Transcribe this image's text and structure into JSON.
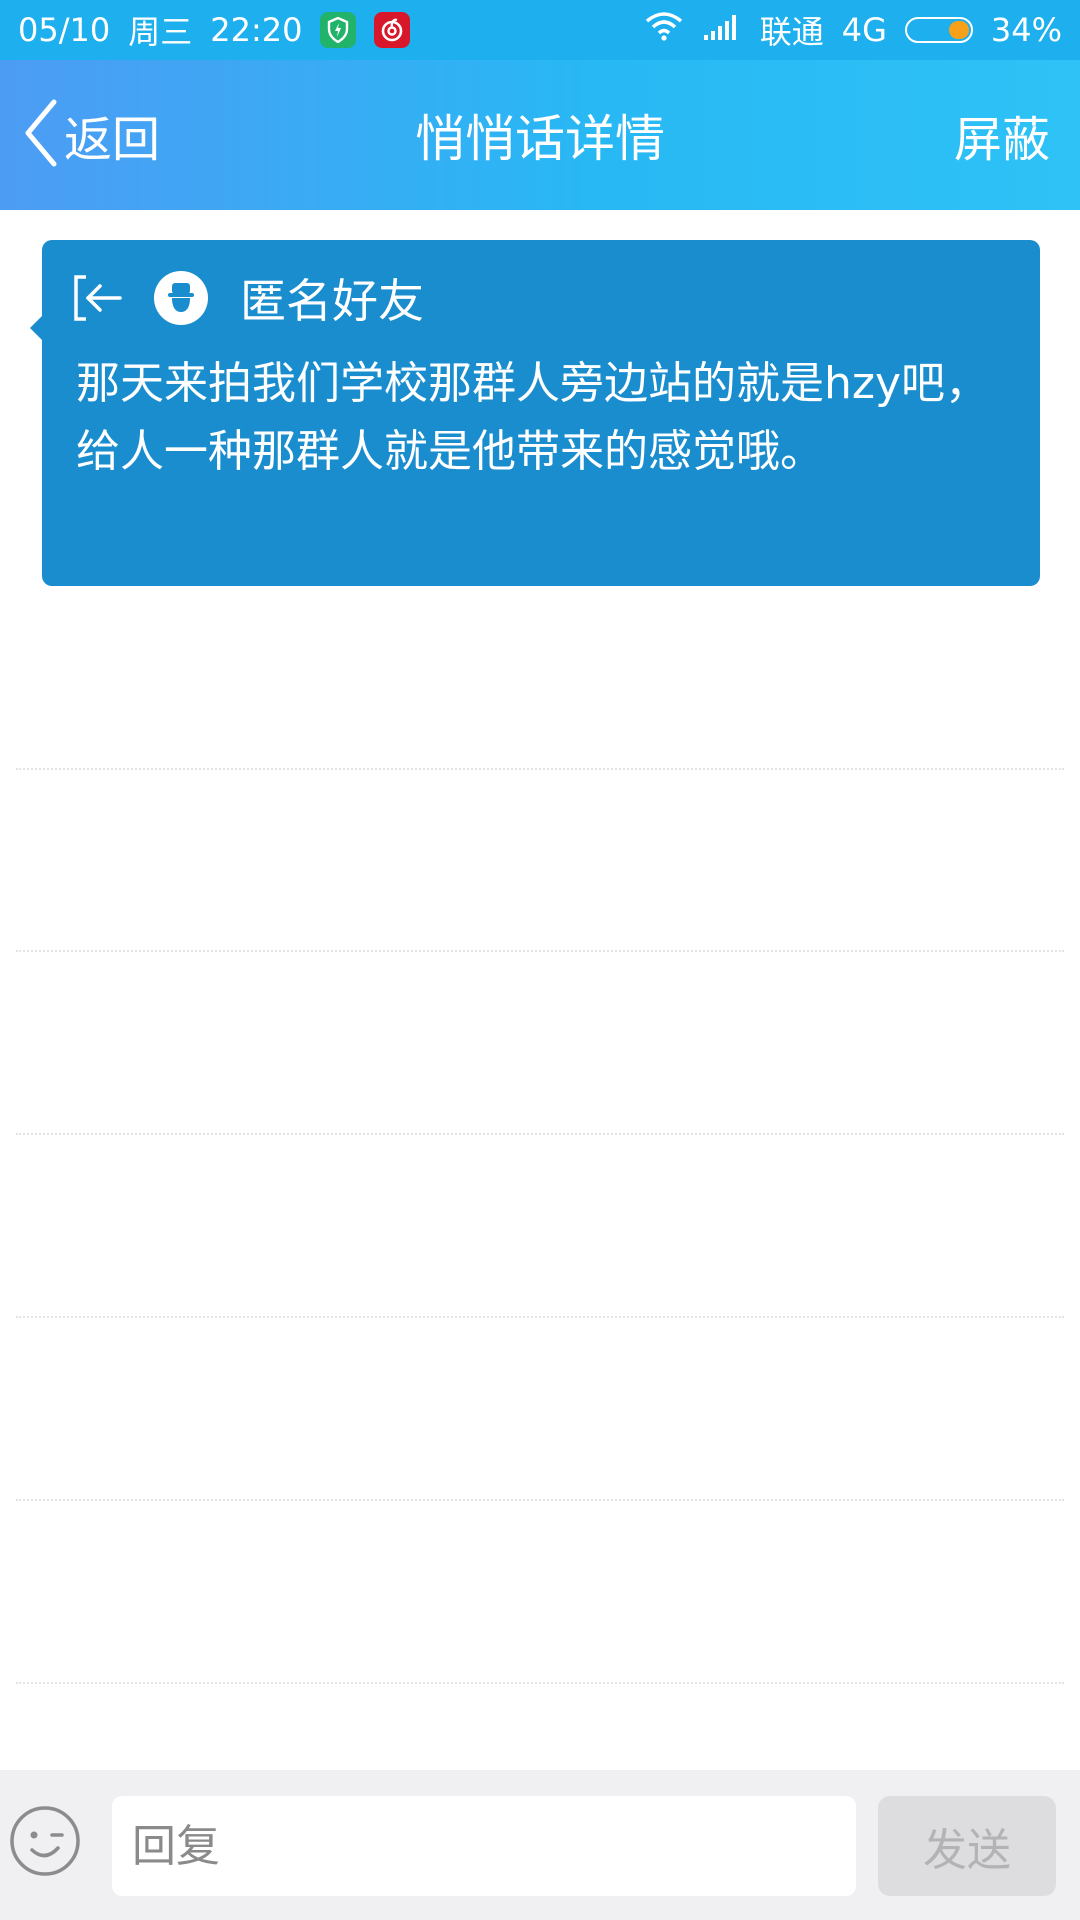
{
  "status_bar": {
    "date": "05/10",
    "weekday": "周三",
    "time": "22:20",
    "carrier": "联通",
    "network": "4G",
    "battery_percent": "34%",
    "battery_level": 0.34,
    "colors": {
      "background": "#1eb0ee",
      "battery_fill": "#f7a11a",
      "app_green": "#21b36a",
      "app_red": "#d8182a"
    }
  },
  "nav": {
    "back_label": "返回",
    "title": "悄悄话详情",
    "block_label": "屏蔽"
  },
  "card": {
    "sender": "匿名好友",
    "message": "那天来拍我们学校那群人旁边站的就是hzy吧，给人一种那群人就是他带来的感觉哦。",
    "colors": {
      "background": "#1a8dcf"
    }
  },
  "input_bar": {
    "reply_placeholder": "回复",
    "send_label": "发送"
  },
  "icons": {
    "status": [
      "shield-app-icon",
      "netease-music-icon",
      "wifi-icon",
      "signal-icon",
      "battery-icon"
    ],
    "nav": [
      "back-chevron-icon"
    ],
    "card": [
      "exit-arrow-icon",
      "anonymous-avatar-icon"
    ],
    "input": [
      "emoji-icon"
    ]
  }
}
